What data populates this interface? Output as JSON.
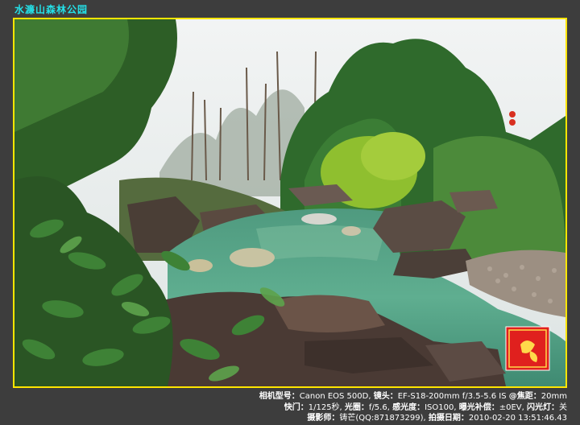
{
  "title": "水濂山森林公园",
  "photo": {
    "description_visible": false,
    "seal": {
      "text": "黄金作品",
      "color": "#e0201e"
    }
  },
  "exif": {
    "line1": {
      "camera_label": "相机型号：",
      "camera_value": "Canon EOS 500D,",
      "lens_label": "镜头：",
      "lens_value": "EF-S18-200mm f/3.5-5.6 IS",
      "focal_label": "@焦距：",
      "focal_value": "20mm"
    },
    "line2": {
      "shutter_label": "快门：",
      "shutter_value": "1/125秒,",
      "aperture_label": "光圈：",
      "aperture_value": "f/5.6,",
      "iso_label": "感光度：",
      "iso_value": "ISO100,",
      "ev_label": "曝光补偿：",
      "ev_value": "±0EV,",
      "flash_label": "闪光灯：",
      "flash_value": "关"
    },
    "line3": {
      "photographer_label": "摄影师：",
      "photographer_value": "铸芒(QQ:871873299),",
      "date_label": "拍摄日期：",
      "date_value": "2010-02-20 13:51:46.43"
    }
  },
  "colors": {
    "title": "#24e0e8",
    "frame_border": "#ffe600",
    "background": "#3d3d3d"
  }
}
